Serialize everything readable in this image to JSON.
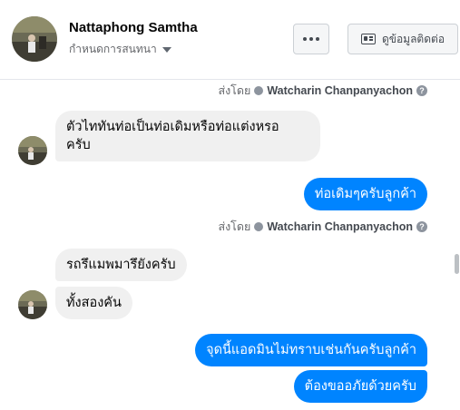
{
  "header": {
    "name": "Nattaphong Samtha",
    "subtitle": "กำหนดการสนทนา",
    "contact_label": "ดูข้อมูลติดต่อ"
  },
  "messages": {
    "sent_by_prefix": "ส่งโดย",
    "sender_1": "Watcharin Chanpanyachon",
    "m1": "ตัวไททันท่อเป็นท่อเดิมหรือท่อแต่งหรอ",
    "m1b": "ครับ",
    "m2": "ท่อเดิมๆครับลูกค้า",
    "sender_2": "Watcharin Chanpanyachon",
    "m3": "รถรึแมพมารึยังครับ",
    "m4": "ทั้งสองคัน",
    "m5": "จุดนี้แอดมินไม่ทราบเช่นกันครับลูกค้า",
    "m6": "ต้องขออภัยด้วยครับ"
  },
  "colors": {
    "outgoing": "#0084ff",
    "incoming": "#f0f0f0"
  }
}
